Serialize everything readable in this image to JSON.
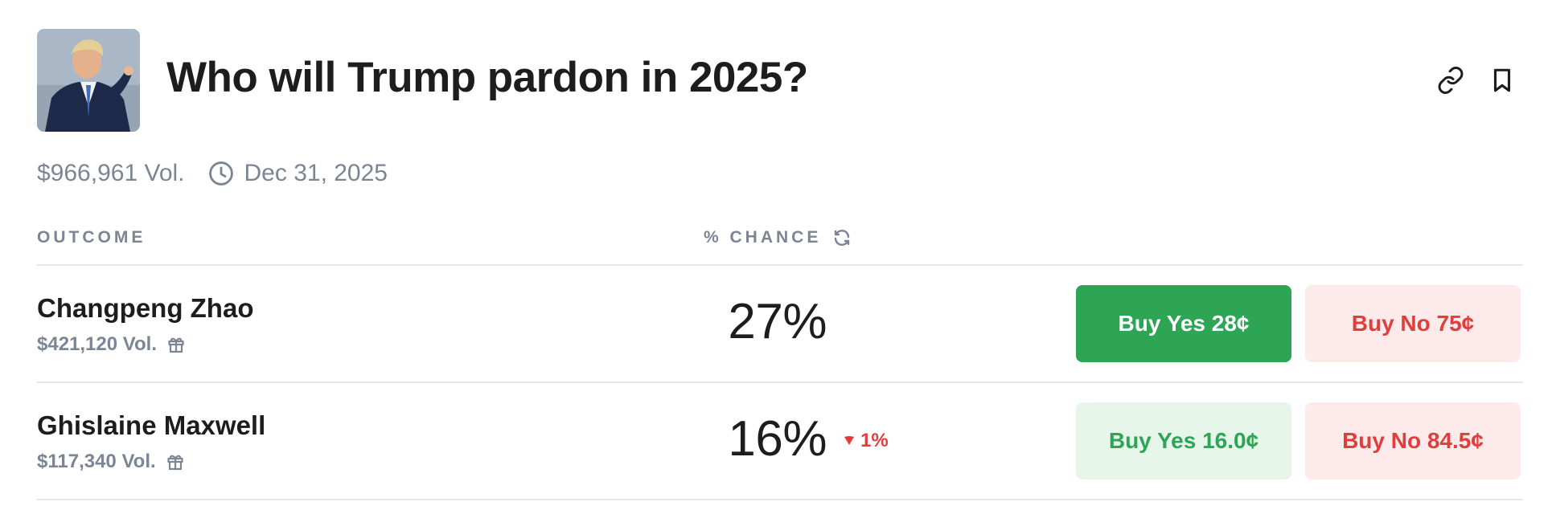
{
  "market": {
    "title": "Who will Trump pardon in 2025?",
    "volume": "$966,961 Vol.",
    "end_date": "Dec 31, 2025",
    "image_icon": "market-image",
    "actions": {
      "link_icon": "link-icon",
      "bookmark_icon": "bookmark-icon"
    }
  },
  "table": {
    "headers": {
      "outcome": "OUTCOME",
      "chance": "% CHANCE"
    },
    "rows": [
      {
        "name": "Changpeng Zhao",
        "volume": "$421,120 Vol.",
        "chance": "27%",
        "change": "",
        "buy_yes": "Buy Yes 28¢",
        "buy_no": "Buy No 75¢"
      },
      {
        "name": "Ghislaine Maxwell",
        "volume": "$117,340 Vol.",
        "chance": "16%",
        "change": "1%",
        "change_direction": "down",
        "buy_yes": "Buy Yes 16.0¢",
        "buy_no": "Buy No 84.5¢"
      }
    ]
  },
  "colors": {
    "yes_green": "#2ea455",
    "yes_soft": "#e6f6ea",
    "no_red": "#e23d3d",
    "no_soft": "#fdeaea",
    "muted": "#7b8594"
  }
}
